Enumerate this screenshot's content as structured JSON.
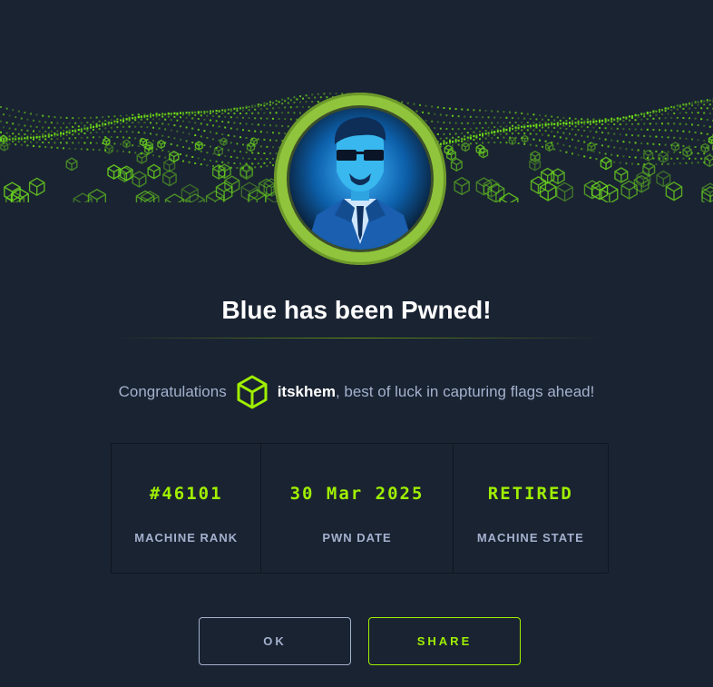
{
  "dialog": {
    "title": "Blue has been Pwned!",
    "congrats_prefix": "Congratulations",
    "username": "itskhem",
    "congrats_suffix": ", best of luck in capturing flags ahead!"
  },
  "stats": [
    {
      "value": "#46101",
      "label": "MACHINE RANK"
    },
    {
      "value": "30 Mar 2025",
      "label": "PWN DATE"
    },
    {
      "value": "RETIRED",
      "label": "MACHINE STATE"
    }
  ],
  "buttons": {
    "ok_label": "OK",
    "share_label": "SHARE"
  },
  "icons": {
    "user_badge": "cube-icon",
    "avatar": "agent-avatar"
  },
  "colors": {
    "background": "#1a2332",
    "accent": "#9fef00",
    "muted": "#a4b1cd",
    "ring": "#8fc43c"
  }
}
